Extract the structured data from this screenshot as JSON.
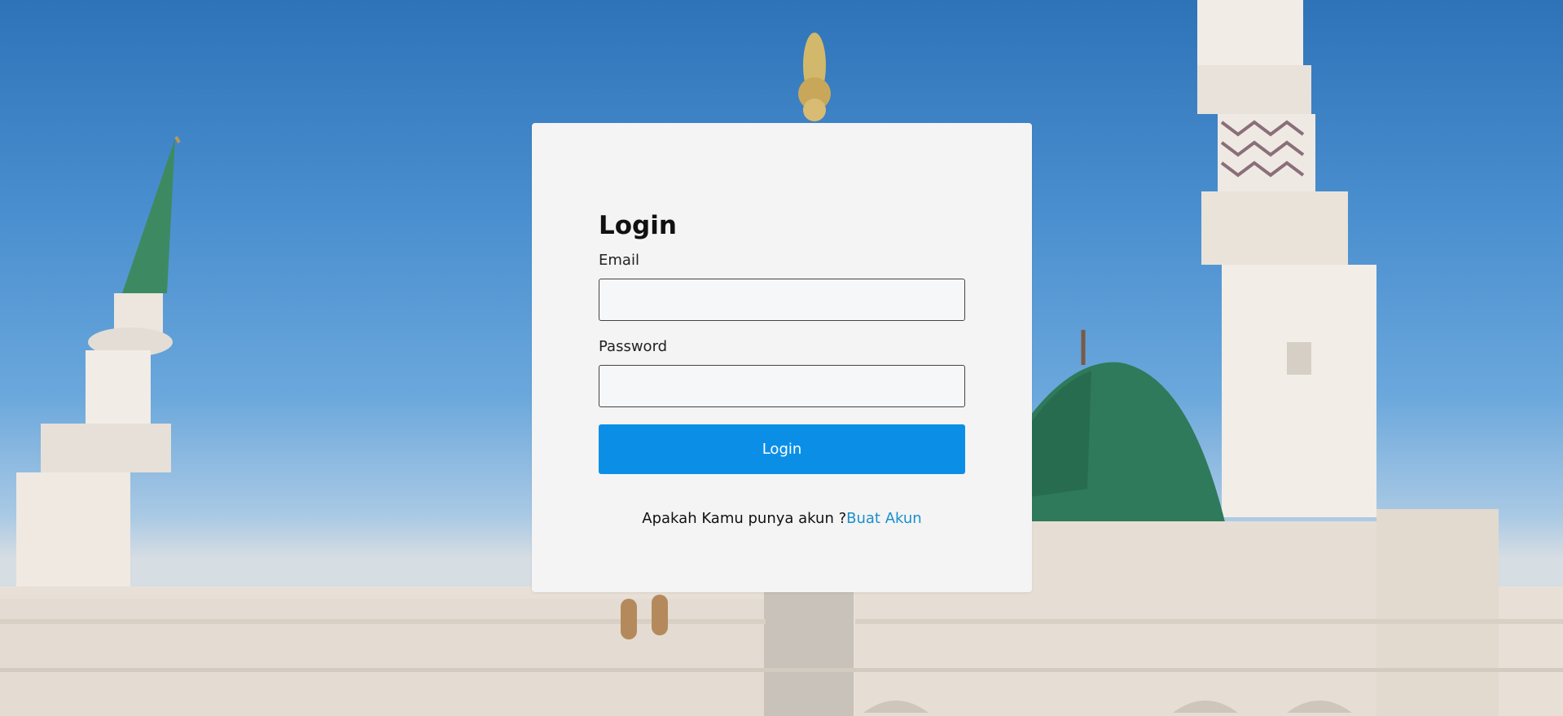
{
  "login": {
    "title": "Login",
    "email_label": "Email",
    "email_value": "",
    "password_label": "Password",
    "password_value": "",
    "button_label": "Login",
    "signup_prompt": "Apakah Kamu punya akun ?",
    "signup_link": "Buat Akun"
  },
  "colors": {
    "button": "#0b8fe6",
    "link": "#1a8fc9",
    "card": "#f4f4f5"
  }
}
